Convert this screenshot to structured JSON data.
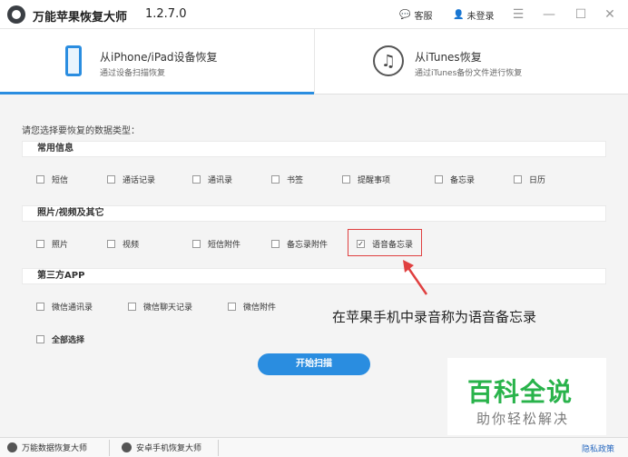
{
  "titlebar": {
    "app_name": "万能苹果恢复大师",
    "version": "1.2.7.0",
    "service_label": "客服",
    "login_label": "未登录"
  },
  "tabs": [
    {
      "title": "从iPhone/iPad设备恢复",
      "subtitle": "通过设备扫描恢复",
      "icon": "phone-icon",
      "active": true
    },
    {
      "title": "从iTunes恢复",
      "subtitle": "通过iTunes备份文件进行恢复",
      "icon": "music-icon",
      "active": false
    }
  ],
  "prompt": "请您选择要恢复的数据类型：",
  "sections": [
    {
      "title": "常用信息",
      "options": [
        "短信",
        "通话记录",
        "通讯录",
        "书签",
        "提醒事项",
        "备忘录",
        "日历"
      ]
    },
    {
      "title": "照片/视频及其它",
      "options": [
        "照片",
        "视频",
        "短信附件",
        "备忘录附件",
        "语音备忘录"
      ]
    },
    {
      "title": "第三方APP",
      "options": [
        "微信通讯录",
        "微信聊天记录",
        "微信附件"
      ]
    }
  ],
  "checked_option": "语音备忘录",
  "select_all_label": "全部选择",
  "scan_button_label": "开始扫描",
  "annotation": "在苹果手机中录音称为语音备忘录",
  "watermark": {
    "title": "百科全说",
    "subtitle": "助你轻松解决"
  },
  "statusbar": {
    "left_item": "万能数据恢复大师",
    "right_item": "安卓手机恢复大师",
    "privacy": "隐私政策"
  },
  "colors": {
    "accent": "#2a8de0",
    "highlight_border": "#e04040",
    "watermark_green": "#29b34b"
  }
}
